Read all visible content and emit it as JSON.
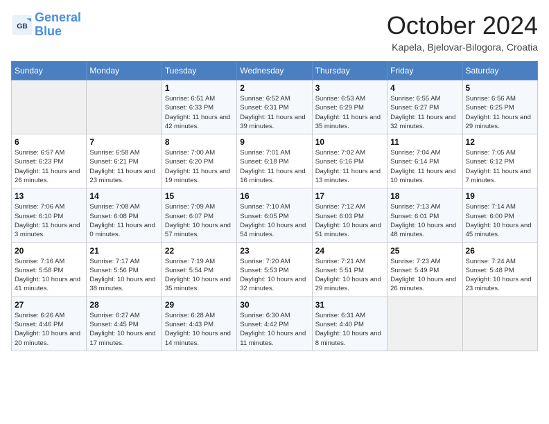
{
  "header": {
    "logo_line1": "General",
    "logo_line2": "Blue",
    "month": "October 2024",
    "location": "Kapela, Bjelovar-Bilogora, Croatia"
  },
  "weekdays": [
    "Sunday",
    "Monday",
    "Tuesday",
    "Wednesday",
    "Thursday",
    "Friday",
    "Saturday"
  ],
  "weeks": [
    [
      {
        "day": "",
        "sunrise": "",
        "sunset": "",
        "daylight": ""
      },
      {
        "day": "",
        "sunrise": "",
        "sunset": "",
        "daylight": ""
      },
      {
        "day": "1",
        "sunrise": "Sunrise: 6:51 AM",
        "sunset": "Sunset: 6:33 PM",
        "daylight": "Daylight: 11 hours and 42 minutes."
      },
      {
        "day": "2",
        "sunrise": "Sunrise: 6:52 AM",
        "sunset": "Sunset: 6:31 PM",
        "daylight": "Daylight: 11 hours and 39 minutes."
      },
      {
        "day": "3",
        "sunrise": "Sunrise: 6:53 AM",
        "sunset": "Sunset: 6:29 PM",
        "daylight": "Daylight: 11 hours and 35 minutes."
      },
      {
        "day": "4",
        "sunrise": "Sunrise: 6:55 AM",
        "sunset": "Sunset: 6:27 PM",
        "daylight": "Daylight: 11 hours and 32 minutes."
      },
      {
        "day": "5",
        "sunrise": "Sunrise: 6:56 AM",
        "sunset": "Sunset: 6:25 PM",
        "daylight": "Daylight: 11 hours and 29 minutes."
      }
    ],
    [
      {
        "day": "6",
        "sunrise": "Sunrise: 6:57 AM",
        "sunset": "Sunset: 6:23 PM",
        "daylight": "Daylight: 11 hours and 26 minutes."
      },
      {
        "day": "7",
        "sunrise": "Sunrise: 6:58 AM",
        "sunset": "Sunset: 6:21 PM",
        "daylight": "Daylight: 11 hours and 23 minutes."
      },
      {
        "day": "8",
        "sunrise": "Sunrise: 7:00 AM",
        "sunset": "Sunset: 6:20 PM",
        "daylight": "Daylight: 11 hours and 19 minutes."
      },
      {
        "day": "9",
        "sunrise": "Sunrise: 7:01 AM",
        "sunset": "Sunset: 6:18 PM",
        "daylight": "Daylight: 11 hours and 16 minutes."
      },
      {
        "day": "10",
        "sunrise": "Sunrise: 7:02 AM",
        "sunset": "Sunset: 6:16 PM",
        "daylight": "Daylight: 11 hours and 13 minutes."
      },
      {
        "day": "11",
        "sunrise": "Sunrise: 7:04 AM",
        "sunset": "Sunset: 6:14 PM",
        "daylight": "Daylight: 11 hours and 10 minutes."
      },
      {
        "day": "12",
        "sunrise": "Sunrise: 7:05 AM",
        "sunset": "Sunset: 6:12 PM",
        "daylight": "Daylight: 11 hours and 7 minutes."
      }
    ],
    [
      {
        "day": "13",
        "sunrise": "Sunrise: 7:06 AM",
        "sunset": "Sunset: 6:10 PM",
        "daylight": "Daylight: 11 hours and 3 minutes."
      },
      {
        "day": "14",
        "sunrise": "Sunrise: 7:08 AM",
        "sunset": "Sunset: 6:08 PM",
        "daylight": "Daylight: 11 hours and 0 minutes."
      },
      {
        "day": "15",
        "sunrise": "Sunrise: 7:09 AM",
        "sunset": "Sunset: 6:07 PM",
        "daylight": "Daylight: 10 hours and 57 minutes."
      },
      {
        "day": "16",
        "sunrise": "Sunrise: 7:10 AM",
        "sunset": "Sunset: 6:05 PM",
        "daylight": "Daylight: 10 hours and 54 minutes."
      },
      {
        "day": "17",
        "sunrise": "Sunrise: 7:12 AM",
        "sunset": "Sunset: 6:03 PM",
        "daylight": "Daylight: 10 hours and 51 minutes."
      },
      {
        "day": "18",
        "sunrise": "Sunrise: 7:13 AM",
        "sunset": "Sunset: 6:01 PM",
        "daylight": "Daylight: 10 hours and 48 minutes."
      },
      {
        "day": "19",
        "sunrise": "Sunrise: 7:14 AM",
        "sunset": "Sunset: 6:00 PM",
        "daylight": "Daylight: 10 hours and 45 minutes."
      }
    ],
    [
      {
        "day": "20",
        "sunrise": "Sunrise: 7:16 AM",
        "sunset": "Sunset: 5:58 PM",
        "daylight": "Daylight: 10 hours and 41 minutes."
      },
      {
        "day": "21",
        "sunrise": "Sunrise: 7:17 AM",
        "sunset": "Sunset: 5:56 PM",
        "daylight": "Daylight: 10 hours and 38 minutes."
      },
      {
        "day": "22",
        "sunrise": "Sunrise: 7:19 AM",
        "sunset": "Sunset: 5:54 PM",
        "daylight": "Daylight: 10 hours and 35 minutes."
      },
      {
        "day": "23",
        "sunrise": "Sunrise: 7:20 AM",
        "sunset": "Sunset: 5:53 PM",
        "daylight": "Daylight: 10 hours and 32 minutes."
      },
      {
        "day": "24",
        "sunrise": "Sunrise: 7:21 AM",
        "sunset": "Sunset: 5:51 PM",
        "daylight": "Daylight: 10 hours and 29 minutes."
      },
      {
        "day": "25",
        "sunrise": "Sunrise: 7:23 AM",
        "sunset": "Sunset: 5:49 PM",
        "daylight": "Daylight: 10 hours and 26 minutes."
      },
      {
        "day": "26",
        "sunrise": "Sunrise: 7:24 AM",
        "sunset": "Sunset: 5:48 PM",
        "daylight": "Daylight: 10 hours and 23 minutes."
      }
    ],
    [
      {
        "day": "27",
        "sunrise": "Sunrise: 6:26 AM",
        "sunset": "Sunset: 4:46 PM",
        "daylight": "Daylight: 10 hours and 20 minutes."
      },
      {
        "day": "28",
        "sunrise": "Sunrise: 6:27 AM",
        "sunset": "Sunset: 4:45 PM",
        "daylight": "Daylight: 10 hours and 17 minutes."
      },
      {
        "day": "29",
        "sunrise": "Sunrise: 6:28 AM",
        "sunset": "Sunset: 4:43 PM",
        "daylight": "Daylight: 10 hours and 14 minutes."
      },
      {
        "day": "30",
        "sunrise": "Sunrise: 6:30 AM",
        "sunset": "Sunset: 4:42 PM",
        "daylight": "Daylight: 10 hours and 11 minutes."
      },
      {
        "day": "31",
        "sunrise": "Sunrise: 6:31 AM",
        "sunset": "Sunset: 4:40 PM",
        "daylight": "Daylight: 10 hours and 8 minutes."
      },
      {
        "day": "",
        "sunrise": "",
        "sunset": "",
        "daylight": ""
      },
      {
        "day": "",
        "sunrise": "",
        "sunset": "",
        "daylight": ""
      }
    ]
  ]
}
